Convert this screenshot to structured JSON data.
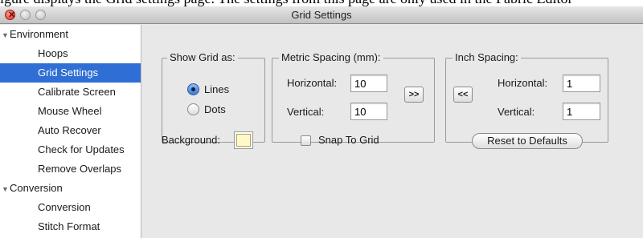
{
  "caption_strip": {
    "text": "igure displays the Grid settings page. The settings from this page are only used in the Fabric Editor"
  },
  "window": {
    "title": "Grid Settings",
    "close_glyph": "✕"
  },
  "sidebar": {
    "groups": [
      {
        "label": "Environment",
        "items": [
          "Hoops",
          "Grid Settings",
          "Calibrate Screen",
          "Mouse Wheel",
          "Auto Recover",
          "Check for Updates",
          "Remove Overlaps"
        ]
      },
      {
        "label": "Conversion",
        "items": [
          "Conversion",
          "Stitch Format"
        ]
      }
    ],
    "selected": "Grid Settings",
    "disclosure_glyph": "▼"
  },
  "grid_settings": {
    "show_grid": {
      "title": "Show Grid as:",
      "options": [
        "Lines",
        "Dots"
      ],
      "selected": "Lines"
    },
    "metric": {
      "title": "Metric Spacing (mm):",
      "horizontal_label": "Horizontal:",
      "horizontal_value": "10",
      "vertical_label": "Vertical:",
      "vertical_value": "10",
      "copy_button_label": ">>"
    },
    "inch": {
      "title": "Inch Spacing:",
      "horizontal_label": "Horizontal:",
      "horizontal_value": "1",
      "vertical_label": "Vertical:",
      "vertical_value": "1",
      "copy_button_label": "<<"
    },
    "background": {
      "label": "Background:",
      "color": "#fff8c8"
    },
    "snap_to_grid": {
      "label": "Snap To Grid",
      "checked": false
    },
    "reset_button_label": "Reset to Defaults"
  }
}
